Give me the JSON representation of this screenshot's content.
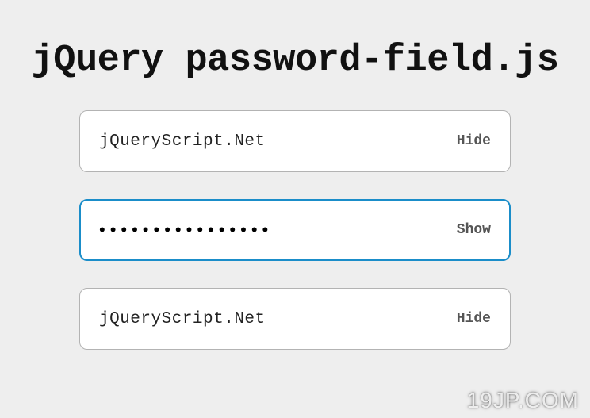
{
  "title": "jQuery password-field.js",
  "fields": [
    {
      "value": "jQueryScript.Net",
      "masked": false,
      "toggle_label": "Hide",
      "focused": false
    },
    {
      "value": "jQueryScript.Net",
      "masked": true,
      "toggle_label": "Show",
      "focused": true
    },
    {
      "value": "jQueryScript.Net",
      "masked": false,
      "toggle_label": "Hide",
      "focused": false
    }
  ],
  "masked_display": "••••••••••••••••",
  "watermark": "19JP.COM"
}
